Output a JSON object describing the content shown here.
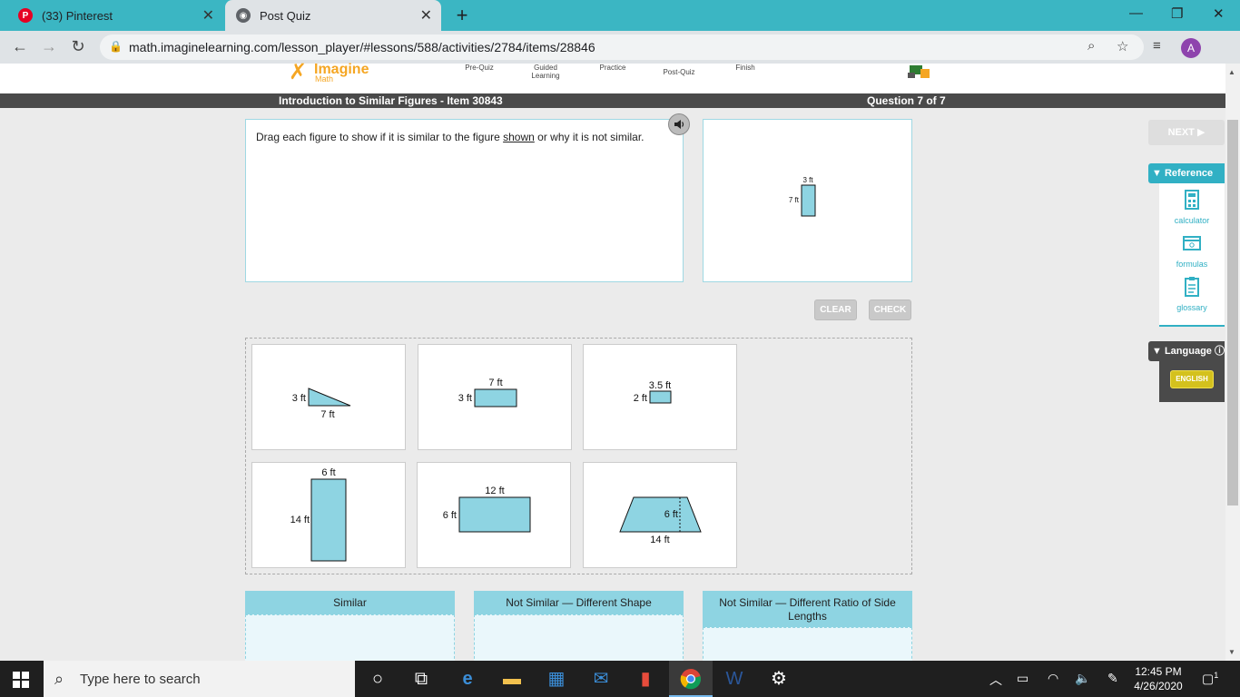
{
  "browser": {
    "tabs": [
      {
        "title": "(33) Pinterest"
      },
      {
        "title": "Post Quiz"
      }
    ],
    "url": "math.imaginelearning.com/lesson_player/#lessons/588/activities/2784/items/28846",
    "profile_initial": "A"
  },
  "header": {
    "logo_text": "Imagine",
    "logo_sub": "Math",
    "steps": [
      "Pre-Quiz",
      "Guided Learning",
      "Practice",
      "Post-Quiz",
      "Finish"
    ]
  },
  "titlebar": {
    "lesson": "Introduction to Similar Figures - Item 30843",
    "progress": "Question 7 of 7"
  },
  "prompt": {
    "before": "Drag each figure to show if it is similar to the figure ",
    "link": "shown",
    "after": " or why it is not similar."
  },
  "target": {
    "width_label": "3 ft",
    "height_label": "7 ft"
  },
  "buttons": {
    "clear": "CLEAR",
    "check": "CHECK",
    "next": "NEXT ▶"
  },
  "figures": [
    {
      "shape": "triangle",
      "labels": {
        "left": "3 ft",
        "bottom": "7 ft"
      }
    },
    {
      "shape": "rectangle",
      "labels": {
        "top": "7 ft",
        "left": "3 ft"
      }
    },
    {
      "shape": "rectangle",
      "labels": {
        "top": "3.5 ft",
        "left": "2 ft"
      }
    },
    {
      "shape": "rectangle",
      "labels": {
        "top": "6 ft",
        "left": "14 ft"
      }
    },
    {
      "shape": "rectangle",
      "labels": {
        "top": "12 ft",
        "left": "6 ft"
      }
    },
    {
      "shape": "trapezoid",
      "labels": {
        "height": "6 ft",
        "bottom": "14 ft"
      }
    }
  ],
  "bins": [
    {
      "label": "Similar"
    },
    {
      "label": "Not Similar — Different Shape"
    },
    {
      "label": "Not Similar — Different Ratio of Side Lengths"
    }
  ],
  "reference": {
    "title": "Reference",
    "items": [
      {
        "label": "calculator",
        "icon": "calculator-icon"
      },
      {
        "label": "formulas",
        "icon": "formulas-icon"
      },
      {
        "label": "glossary",
        "icon": "glossary-icon"
      }
    ]
  },
  "language": {
    "title": "Language",
    "current": "ENGLISH"
  },
  "taskbar": {
    "search_placeholder": "Type here to search",
    "time": "12:45 PM",
    "date": "4/26/2020",
    "notification_count": "1"
  },
  "colors": {
    "accent": "#31b0c4",
    "figure_fill": "#8ed4e2",
    "bin_header": "#8ed4e2"
  }
}
